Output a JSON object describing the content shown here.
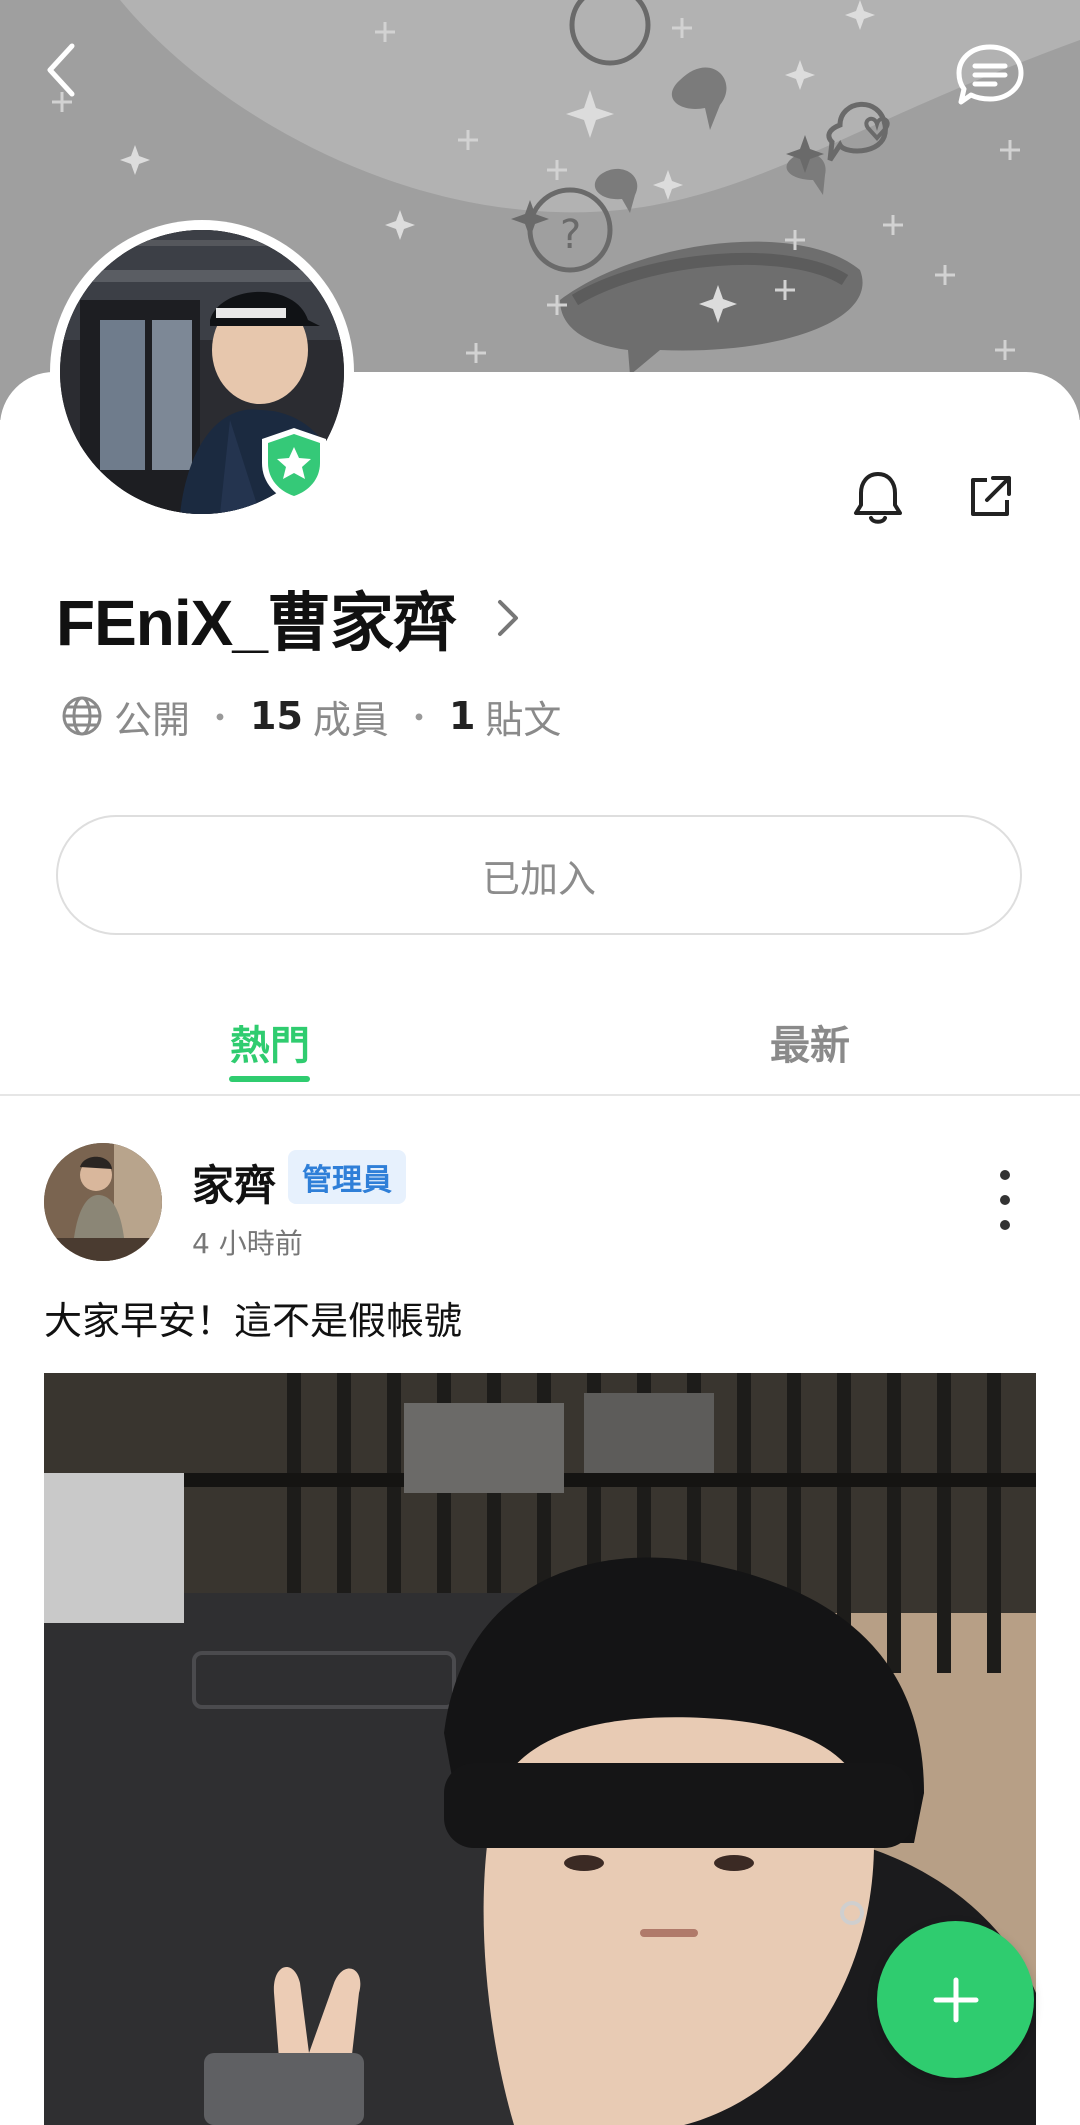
{
  "app": {
    "accent_color": "#2fcc6f",
    "banner_color": "#a9a9a9"
  },
  "header": {
    "back_icon": "chevron-left-icon",
    "chat_icon": "chat-bubble-icon"
  },
  "profile": {
    "name": "FEniX_曹家齊",
    "verified_badge_icon": "shield-star-icon",
    "notify_icon": "bell-icon",
    "share_icon": "external-share-icon",
    "visibility_icon": "globe-icon",
    "visibility": "公開",
    "member_count": "15",
    "member_label": "成員",
    "post_count": "1",
    "post_label": "貼文",
    "separator": "・",
    "join_status": "已加入"
  },
  "tabs": [
    {
      "label": "熱門",
      "active": true
    },
    {
      "label": "最新",
      "active": false
    }
  ],
  "post": {
    "author": "家齊",
    "role_badge": "管理員",
    "time": "4 小時前",
    "text": "大家早安！這不是假帳號",
    "more_icon": "more-vertical-icon"
  },
  "fab": {
    "icon": "plus-icon"
  }
}
